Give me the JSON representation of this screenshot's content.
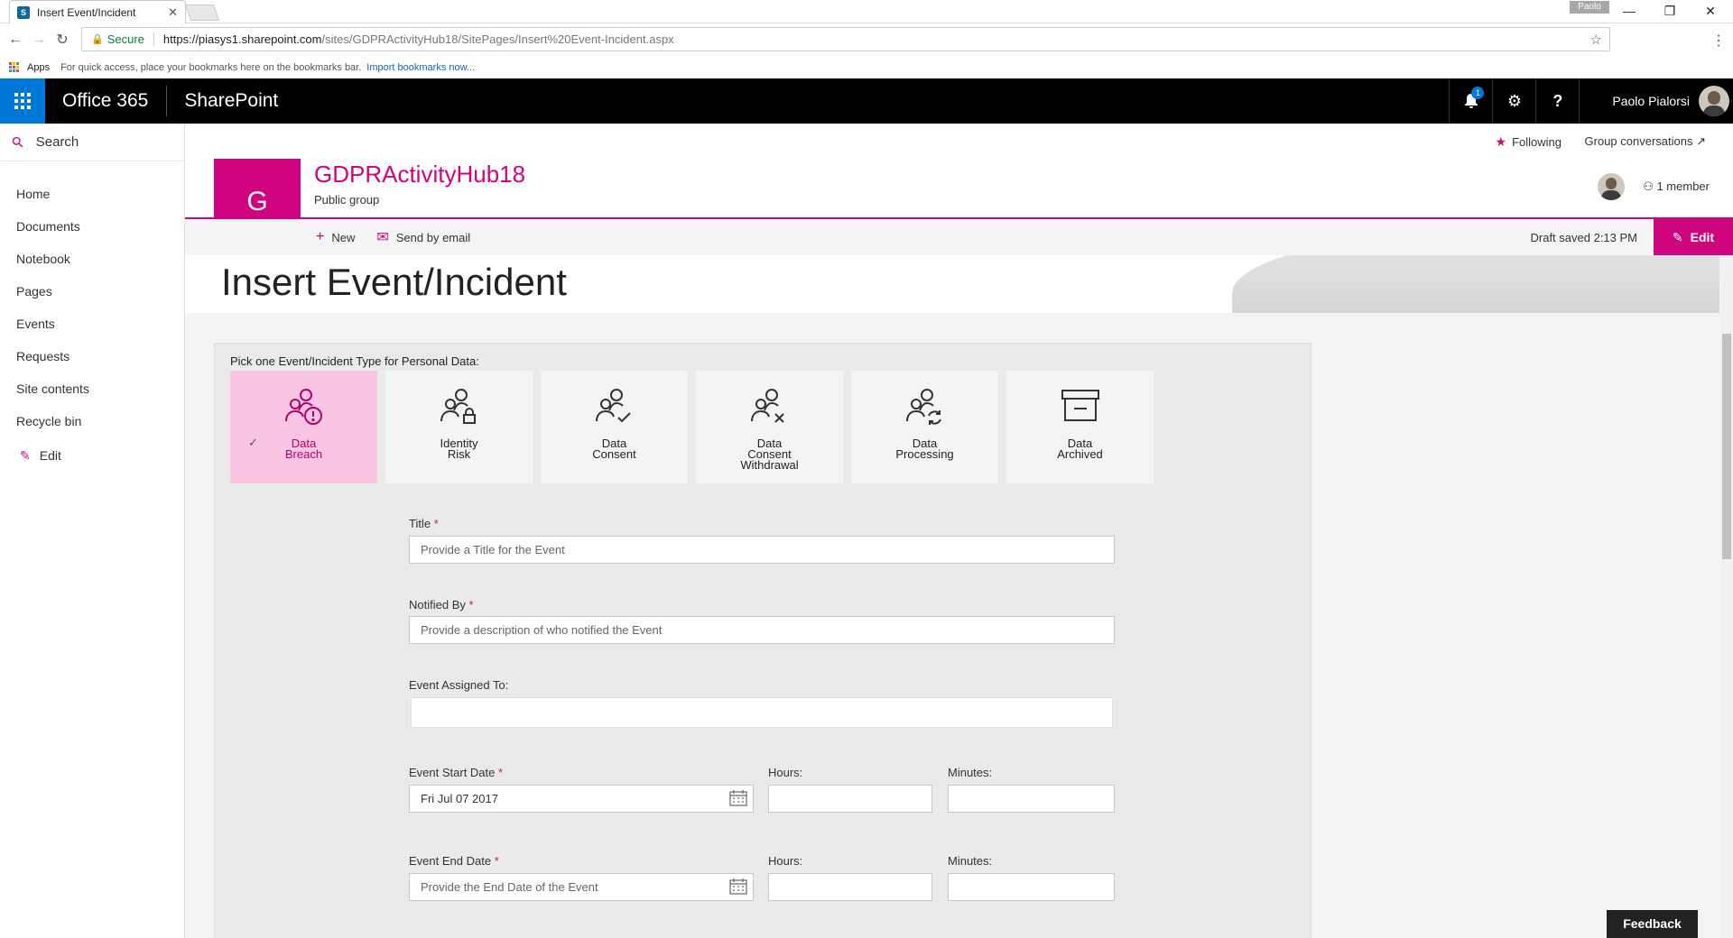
{
  "browser": {
    "tab_title": "Insert Event/Incident",
    "favicon_text": "S",
    "profile": "Paolo",
    "secure_label": "Secure",
    "url_host": "https://piasys1.sharepoint.com",
    "url_path": "/sites/GDPRActivityHub18/SitePages/Insert%20Event-Incident.aspx",
    "bookmarks": {
      "apps": "Apps",
      "message": "For quick access, place your bookmarks here on the bookmarks bar.",
      "import_link": "Import bookmarks now..."
    }
  },
  "suitebar": {
    "office": "Office 365",
    "app": "SharePoint",
    "notification_count": "1",
    "user": "Paolo Pialorsi"
  },
  "leftnav": {
    "search": "Search",
    "items": [
      "Home",
      "Documents",
      "Notebook",
      "Pages",
      "Events",
      "Requests",
      "Site contents",
      "Recycle bin"
    ],
    "edit": "Edit"
  },
  "site": {
    "logo_letter": "G",
    "title": "GDPRActivityHub18",
    "subtitle": "Public group",
    "following": "Following",
    "group_conversations": "Group conversations ↗",
    "members": "1 member"
  },
  "commandbar": {
    "new": "New",
    "send_email": "Send by email",
    "draft": "Draft saved 2:13 PM",
    "edit": "Edit"
  },
  "page": {
    "title": "Insert Event/Incident"
  },
  "form": {
    "pick_label": "Pick one Event/Incident Type for Personal Data:",
    "types": [
      {
        "label": "Data\nBreach",
        "icon": "people-alert-icon",
        "selected": true
      },
      {
        "label": "Identity\nRisk",
        "icon": "people-lock-icon",
        "selected": false
      },
      {
        "label": "Data\nConsent",
        "icon": "people-check-icon",
        "selected": false
      },
      {
        "label": "Data\nConsent\nWithdrawal",
        "icon": "people-x-icon",
        "selected": false
      },
      {
        "label": "Data\nProcessing",
        "icon": "people-sync-icon",
        "selected": false
      },
      {
        "label": "Data\nArchived",
        "icon": "archive-box-icon",
        "selected": false
      }
    ],
    "title_label": "Title",
    "title_placeholder": "Provide a Title for the Event",
    "notified_label": "Notified By",
    "notified_placeholder": "Provide a description of who notified the Event",
    "assigned_label": "Event Assigned To:",
    "start_label": "Event Start Date",
    "start_value": "Fri Jul 07 2017",
    "end_label": "Event End Date",
    "end_placeholder": "Provide the End Date of the Event",
    "hours_label": "Hours:",
    "minutes_label": "Minutes:",
    "required_mark": "*"
  },
  "feedback": "Feedback",
  "colors": {
    "accent": "#d0047f",
    "selected_bg": "#f9c5e3",
    "suite_bg": "#000000",
    "waffle_bg": "#0078d7"
  }
}
